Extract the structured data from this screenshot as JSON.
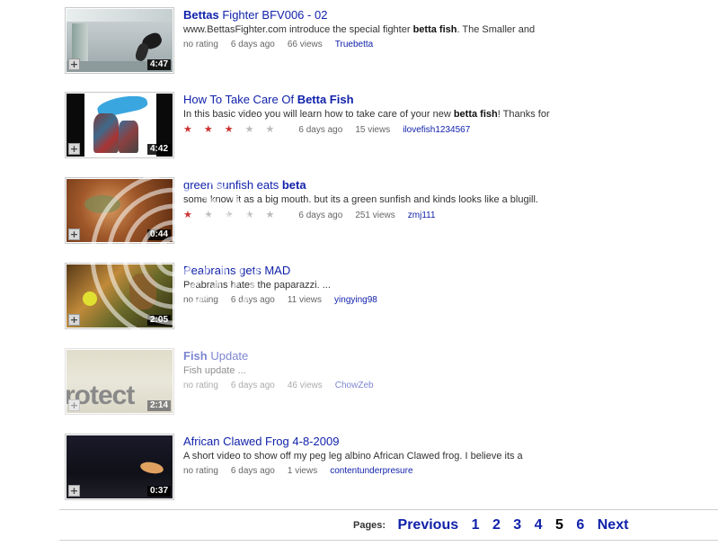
{
  "results": [
    {
      "title_bold": "Bettas",
      "title_rest": " Fighter BFV006 - 02",
      "desc_pre": "www.BettasFighter.com introduce the special fighter ",
      "desc_bold": "betta fish",
      "desc_post": ". The Smaller and",
      "rating": "no rating",
      "age": "6 days ago",
      "views": "66 views",
      "user": "Truebetta",
      "duration": "4:47"
    },
    {
      "title_pre": "How To Take Care Of ",
      "title_bold": "Betta Fish",
      "desc_pre": "In this basic video you will learn how to take care of your new ",
      "desc_bold": "betta fish",
      "desc_post": "! Thanks for",
      "stars": 3,
      "age": "6 days ago",
      "views": "15 views",
      "user": "ilovefish1234567",
      "duration": "4:42"
    },
    {
      "title_pre": "green sunfish eats ",
      "title_bold": "beta",
      "desc": "some know it as a big mouth. but its a green sunfish and kinds looks like a blugill.",
      "stars": 1,
      "age": "6 days ago",
      "views": "251 views",
      "user": "zmj111",
      "duration": "0:44"
    },
    {
      "title": "Peabrains gets MAD",
      "desc": "Peabrains hates the paparazzi. ...",
      "rating": "no rating",
      "age": "6 days ago",
      "views": "11 views",
      "user": "yingying98",
      "duration": "2:05"
    },
    {
      "title_bold": "Fish",
      "title_rest": " Update",
      "desc": "Fish update ...",
      "rating": "no rating",
      "age": "6 days ago",
      "views": "46 views",
      "user": "ChowZeb",
      "duration": "2:14",
      "thumb_text": "rotect"
    },
    {
      "title": "African Clawed Frog 4-8-2009",
      "desc": "A short video to show off my peg leg albino African Clawed frog. I believe its a",
      "rating": "no rating",
      "age": "6 days ago",
      "views": "1 views",
      "user": "contentunderpresure",
      "duration": "0:37"
    }
  ],
  "pager": {
    "label": "Pages:",
    "previous": "Previous",
    "pages": [
      "1",
      "2",
      "3",
      "4",
      "5",
      "6"
    ],
    "current": "5",
    "next": "Next"
  },
  "icons": {
    "add": "+",
    "star": "★"
  },
  "colors": {
    "link": "#1122aa",
    "star_on": "#cc3333",
    "star_off": "#bbbbbb"
  }
}
